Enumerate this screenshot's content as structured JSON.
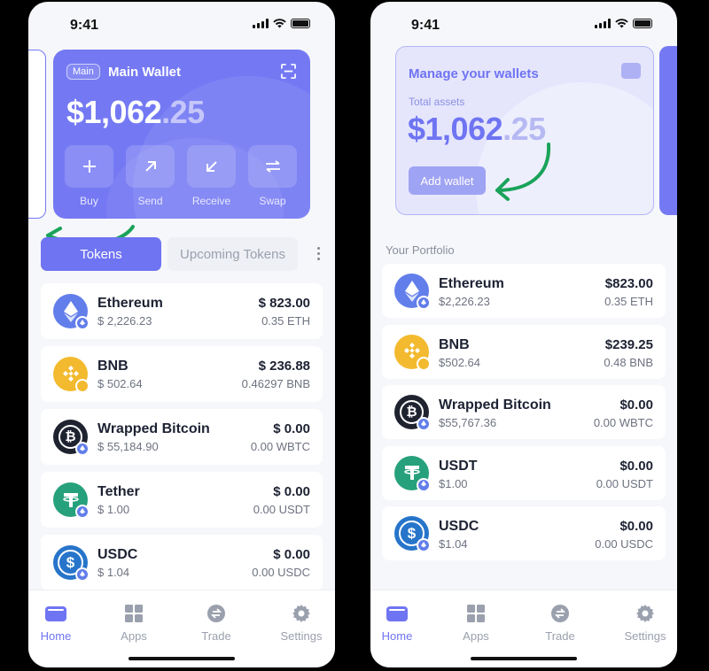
{
  "status_time": "9:41",
  "phoneA": {
    "wallet": {
      "chip": "Main",
      "name": "Main Wallet",
      "balance_main": "$1,062",
      "balance_dec": ".25"
    },
    "actions": [
      {
        "label": "Buy",
        "icon": "plus-icon"
      },
      {
        "label": "Send",
        "icon": "arrow-up-right-icon"
      },
      {
        "label": "Receive",
        "icon": "arrow-down-left-icon"
      },
      {
        "label": "Swap",
        "icon": "swap-icon"
      }
    ],
    "tabs": {
      "active": "Tokens",
      "inactive": "Upcoming Tokens"
    },
    "tokens": [
      {
        "name": "Ethereum",
        "price": "$ 2,226.23",
        "value": "$ 823.00",
        "amount": "0.35 ETH",
        "icon": "ethereum-icon"
      },
      {
        "name": "BNB",
        "price": "$ 502.64",
        "value": "$ 236.88",
        "amount": "0.46297 BNB",
        "icon": "bnb-icon"
      },
      {
        "name": "Wrapped Bitcoin",
        "price": "$ 55,184.90",
        "value": "$ 0.00",
        "amount": "0.00 WBTC",
        "icon": "bitcoin-icon"
      },
      {
        "name": "Tether",
        "price": "$ 1.00",
        "value": "$ 0.00",
        "amount": "0.00 USDT",
        "icon": "tether-icon"
      },
      {
        "name": "USDC",
        "price": "$ 1.04",
        "value": "$ 0.00",
        "amount": "0.00 USDC",
        "icon": "usdc-icon"
      }
    ]
  },
  "phoneB": {
    "card": {
      "title": "Manage your wallets",
      "label": "Total assets",
      "balance_main": "$1,062",
      "balance_dec": ".25",
      "button": "Add wallet"
    },
    "section_label": "Your Portfolio",
    "tokens": [
      {
        "name": "Ethereum",
        "price": "$2,226.23",
        "value": "$823.00",
        "amount": "0.35 ETH",
        "icon": "ethereum-icon"
      },
      {
        "name": "BNB",
        "price": "$502.64",
        "value": "$239.25",
        "amount": "0.48 BNB",
        "icon": "bnb-icon"
      },
      {
        "name": "Wrapped Bitcoin",
        "price": "$55,767.36",
        "value": "$0.00",
        "amount": "0.00 WBTC",
        "icon": "bitcoin-icon"
      },
      {
        "name": "USDT",
        "price": "$1.00",
        "value": "$0.00",
        "amount": "0.00 USDT",
        "icon": "tether-icon"
      },
      {
        "name": "USDC",
        "price": "$1.04",
        "value": "$0.00",
        "amount": "0.00 USDC",
        "icon": "usdc-icon"
      }
    ]
  },
  "nav": [
    {
      "label": "Home",
      "icon": "wallet-icon"
    },
    {
      "label": "Apps",
      "icon": "apps-icon"
    },
    {
      "label": "Trade",
      "icon": "trade-icon"
    },
    {
      "label": "Settings",
      "icon": "gear-icon"
    }
  ],
  "colors": {
    "accent": "#6f74f2",
    "card": "#7479f3",
    "ethereum": "#627eea",
    "bnb": "#f3ba2f",
    "bitcoin": "#1f2330",
    "tether": "#26a17b",
    "usdc": "#2775ca",
    "annotation_arrow": "#1aa35a"
  }
}
